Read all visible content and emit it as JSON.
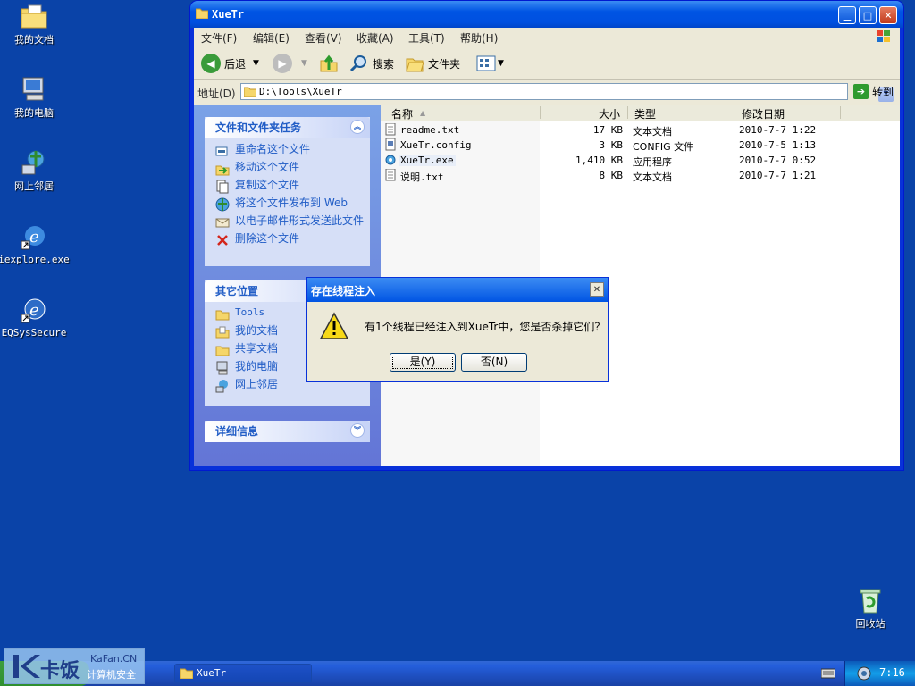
{
  "desktop": {
    "icons": [
      {
        "label": "我的文档",
        "icon": "folder-documents-icon"
      },
      {
        "label": "我的电脑",
        "icon": "computer-icon"
      },
      {
        "label": "网上邻居",
        "icon": "network-icon"
      },
      {
        "label": "iexplore.exe",
        "icon": "ie-icon"
      },
      {
        "label": "EQSysSecure",
        "icon": "ie-icon"
      },
      {
        "label": "回收站",
        "icon": "recycle-bin-icon"
      }
    ]
  },
  "window": {
    "title": "XueTr",
    "menu": [
      "文件(F)",
      "编辑(E)",
      "查看(V)",
      "收藏(A)",
      "工具(T)",
      "帮助(H)"
    ],
    "toolbar": {
      "back": "后退",
      "search": "搜索",
      "folders": "文件夹"
    },
    "address": {
      "label": "地址(D)",
      "value": "D:\\Tools\\XueTr",
      "go": "转到"
    },
    "tasks_panel": {
      "title": "文件和文件夹任务",
      "items": [
        "重命名这个文件",
        "移动这个文件",
        "复制这个文件",
        "将这个文件发布到 Web",
        "以电子邮件形式发送此文件",
        "删除这个文件"
      ]
    },
    "places_panel": {
      "title": "其它位置",
      "items": [
        "Tools",
        "我的文档",
        "共享文档",
        "我的电脑",
        "网上邻居"
      ]
    },
    "details_panel": {
      "title": "详细信息"
    },
    "columns": [
      "名称",
      "大小",
      "类型",
      "修改日期"
    ],
    "files": [
      {
        "name": "readme.txt",
        "size": "17 KB",
        "type": "文本文档",
        "date": "2010-7-7 1:22"
      },
      {
        "name": "XueTr.config",
        "size": "3 KB",
        "type": "CONFIG 文件",
        "date": "2010-7-5 1:13"
      },
      {
        "name": "XueTr.exe",
        "size": "1,410 KB",
        "type": "应用程序",
        "date": "2010-7-7 0:52"
      },
      {
        "name": "说明.txt",
        "size": "8 KB",
        "type": "文本文档",
        "date": "2010-7-7 1:21"
      }
    ]
  },
  "dialog": {
    "title": "存在线程注入",
    "message": "有1个线程已经注入到XueTr中，您是否杀掉它们？",
    "yes": "是(Y)",
    "no": "否(N)"
  },
  "taskbar": {
    "task_title": "XueTr",
    "clock": "7:16"
  },
  "watermark": {
    "brand": "卡饭",
    "site": "KaFan.CN",
    "tagline": "计算机安全"
  }
}
